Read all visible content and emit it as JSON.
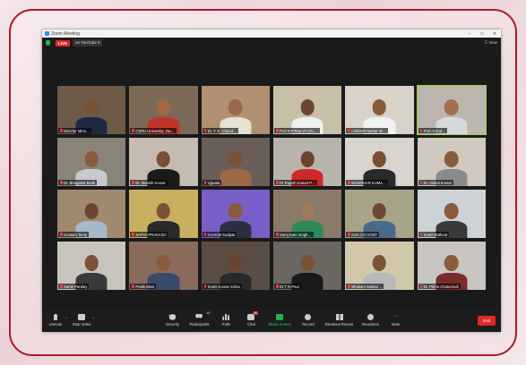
{
  "window": {
    "title": "Zoom Meeting",
    "minimize": "–",
    "maximize": "□",
    "close": "✕"
  },
  "topbar": {
    "live_label": "LIVE",
    "stream_label": "on YouTube ▾",
    "view_label": "⠿ View"
  },
  "participants": [
    {
      "name": "Director Mine…",
      "bg": "#6e5a48",
      "skin": "#7a5236",
      "shirt": "#1e2a44"
    },
    {
      "name": "CSRU University ,Na…",
      "bg": "#7b6a58",
      "skin": "#a06a45",
      "shirt": "#c0342c"
    },
    {
      "name": "Dr. T. K. Chand…",
      "bg": "#b09070",
      "skin": "#9a6a48",
      "shirt": "#e8e0d0"
    },
    {
      "name": "Prof D.P.Rao,VC,DU…",
      "bg": "#c8bfa8",
      "skin": "#6a4630",
      "shirt": "#f0f0f0"
    },
    {
      "name": "mithilesh kumar mi…",
      "bg": "#d8d2c8",
      "skin": "#8a5a38",
      "shirt": "#f2f2f2"
    },
    {
      "name": "Prof Arvind…",
      "bg": "#bcb6ae",
      "skin": "#a07050",
      "shirt": "#d8d8d8",
      "active": true
    },
    {
      "name": "Dr. Bhagabat Barik",
      "bg": "#8a8478",
      "skin": "#8a5a3c",
      "shirt": "#c8c8d0"
    },
    {
      "name": "Dr. Manish Kumar",
      "bg": "#c4bcb0",
      "skin": "#7a5034",
      "shirt": "#1a1a1a"
    },
    {
      "name": "Ujjwala",
      "bg": "#6a5e58",
      "skin": "#7a5238",
      "shirt": "#9a6a48"
    },
    {
      "name": "Dr Rajesh Kumar P…",
      "bg": "#b8b4ac",
      "skin": "#6a4430",
      "shirt": "#cc2a2a"
    },
    {
      "name": "MANOHAR KUMA…",
      "bg": "#d8d4ce",
      "skin": "#7a4e32",
      "shirt": "#2a2a2a"
    },
    {
      "name": "Dr. Vishal Kumar",
      "bg": "#cfc9c0",
      "skin": "#8a5c3e",
      "shirt": "#8a8a8a"
    },
    {
      "name": "Goutam Tanty",
      "bg": "#a08a6e",
      "skin": "#6a4630",
      "shirt": "#a8b8c8"
    },
    {
      "name": "SATYA PRAKASH",
      "bg": "#c8b060",
      "skin": "#7a5236",
      "shirt": "#2a2a2a"
    },
    {
      "name": "Co-Host Sudipta",
      "bg": "#7a5ec8",
      "skin": "#8a5a3c",
      "shirt": "#2a3040"
    },
    {
      "name": "Saroj Kant Singh…",
      "bg": "#8a7a6a",
      "skin": "#a07a5a",
      "shirt": "#2e8a5a"
    },
    {
      "name": "IUIH CO HOST",
      "bg": "#a8a48a",
      "skin": "#6a4a34",
      "shirt": "#4a6a8a"
    },
    {
      "name": "Sumit Rathour",
      "bg": "#cdd2d6",
      "skin": "#8a5a3c",
      "shirt": "#3a3a3a"
    },
    {
      "name": "Samir Pandey",
      "bg": "#c8c4bc",
      "skin": "#7a5238",
      "shirt": "#3a3a3a"
    },
    {
      "name": "Pratik Bisoi",
      "bg": "#8a6a5a",
      "skin": "#8a5a3c",
      "shirt": "#3a4a6a"
    },
    {
      "name": "Sumit Kumar Sinha",
      "bg": "#5a4e44",
      "skin": "#6a4430",
      "shirt": "#2a2a2a"
    },
    {
      "name": "Dr T N Paul",
      "bg": "#6a6660",
      "skin": "#7a5034",
      "shirt": "#1a1a1a"
    },
    {
      "name": "Bhabani Sankar…",
      "bg": "#d0c8a8",
      "skin": "#7a5236",
      "shirt": "#b8b8b8"
    },
    {
      "name": "Dr. Pritha Chaturvedi",
      "bg": "#c8c4c0",
      "skin": "#8a5a3c",
      "shirt": "#7a2a2a"
    }
  ],
  "toolbar": {
    "unmute": "Unmute",
    "stop_video": "Stop Video",
    "security": "Security",
    "participants": "Participants",
    "participants_count": "45",
    "polls": "Polls",
    "chat": "Chat",
    "chat_badge": "10",
    "share_screen": "Share Screen",
    "record": "Record",
    "breakout": "Breakout Rooms",
    "reactions": "Reactions",
    "more": "More",
    "end": "End"
  }
}
